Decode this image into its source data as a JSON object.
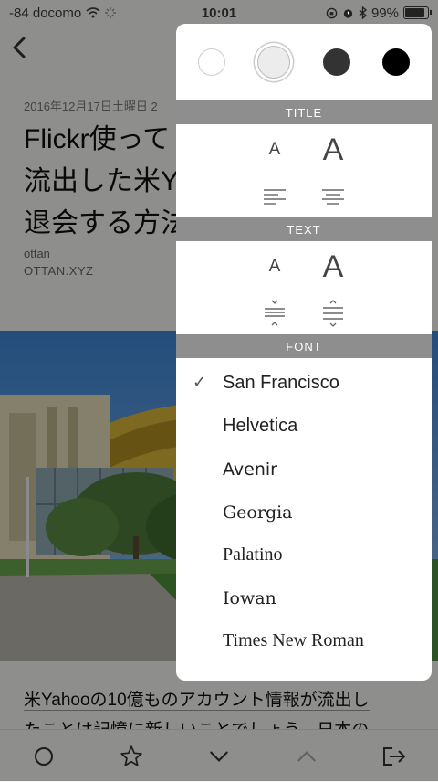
{
  "status_bar": {
    "carrier": "-84 docomo",
    "time": "10:01",
    "battery": "99%"
  },
  "article": {
    "date": "2016年12月17日土曜日 2",
    "title_lines": [
      "Flickr使って",
      "流出した米Y",
      "退会する方法"
    ],
    "author": "ottan",
    "site": "OTTAN.XYZ",
    "body_linked": "米Yahooの10億ものアカウント情報が流出し",
    "body_rest": "たことは記憶に新しいことでしょう。日本の"
  },
  "toolbar": {
    "icons": [
      "circle-icon",
      "star-icon",
      "chevron-down-icon",
      "chevron-up-icon",
      "share-out-icon"
    ]
  },
  "popover": {
    "themes": [
      {
        "name": "white",
        "color": "#ffffff",
        "border": "#cccccc"
      },
      {
        "name": "light-gray",
        "color": "#e8e8e8",
        "border": "#bbbbbb",
        "selected": true
      },
      {
        "name": "dark-gray",
        "color": "#333333",
        "border": "#333333"
      },
      {
        "name": "black",
        "color": "#000000",
        "border": "#000000"
      }
    ],
    "title_header": "TITLE",
    "text_header": "TEXT",
    "font_header": "FONT",
    "size_small_glyph": "A",
    "size_large_glyph": "A",
    "fonts": [
      {
        "label": "San Francisco",
        "family": "Liberation Sans, sans-serif",
        "selected": true
      },
      {
        "label": "Helvetica",
        "family": "Liberation Sans, sans-serif",
        "selected": false
      },
      {
        "label": "Avenir",
        "family": "DejaVu Sans, sans-serif",
        "selected": false
      },
      {
        "label": "Georgia",
        "family": "DejaVu Serif, serif",
        "selected": false
      },
      {
        "label": "Palatino",
        "family": "Liberation Serif, serif",
        "selected": false
      },
      {
        "label": "Iowan",
        "family": "DejaVu Serif, serif",
        "selected": false
      },
      {
        "label": "Times New Roman",
        "family": "Liberation Serif, serif",
        "selected": false
      }
    ],
    "check_glyph": "✓"
  }
}
